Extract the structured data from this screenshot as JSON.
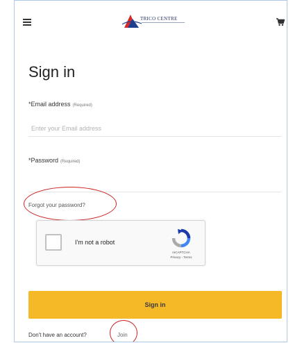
{
  "header": {
    "menu_icon": "hamburger-menu-icon",
    "logo_text": "TRICO CENTRE",
    "cart_icon": "shopping-cart-icon"
  },
  "form": {
    "title": "Sign in",
    "email": {
      "label": "*Email address",
      "required_note": "(Required)",
      "value": "",
      "placeholder": "Enter your Email address"
    },
    "password": {
      "label": "*Password",
      "required_note": "(Required)",
      "value": "",
      "placeholder": ""
    },
    "forgot_link": "Forgot your password?",
    "recaptcha": {
      "label": "I'm not a robot",
      "brand": "reCAPTCHA",
      "terms": "Privacy - Terms"
    },
    "submit_label": "Sign in",
    "signup_prompt": "Don't have an account?",
    "signup_link": "Join"
  },
  "colors": {
    "accent": "#f5b928",
    "annotation": "#cc2222",
    "frame_border": "#aec8ea"
  }
}
